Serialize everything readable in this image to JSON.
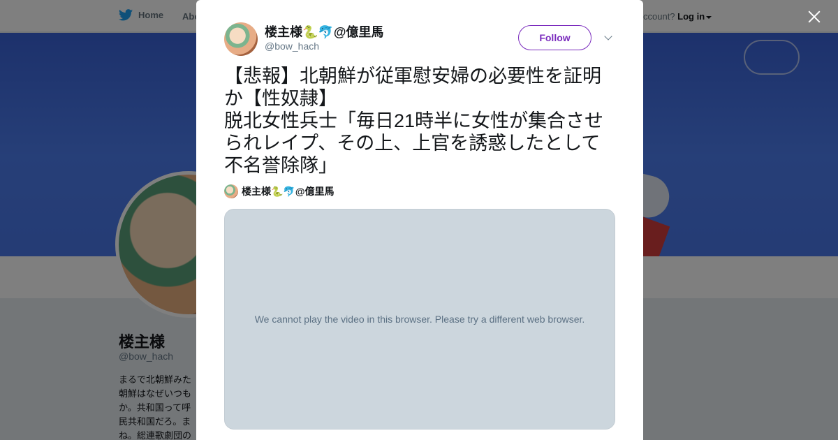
{
  "topbar": {
    "home_label": "Home",
    "about_label": "Abo",
    "account_prompt": "ccount?",
    "login_label": "Log in"
  },
  "profile": {
    "name": "楼主様",
    "handle": "@bow_hach",
    "bio_lines": [
      "まるで北朝鮮みた",
      "朝鮮はなぜいつも",
      "か。共和国って呼",
      "民共和国だろ。ま",
      "ね。総連歌劇団の"
    ]
  },
  "tweet": {
    "author_name": "楼主様🐍🐬@億里馬",
    "author_handle": "@bow_hach",
    "follow_label": "Follow",
    "text": "【悲報】北朝鮮が従軍慰安婦の必要性を証明か【性奴隷】\n脱北女性兵士「毎日21時半に女性が集合させられレイプ、その上、上官を誘惑したとして不名誉除隊」",
    "quote_name": "楼主様🐍🐬@億里馬",
    "video_message": "We cannot play the video in this browser. Please try a different web browser."
  },
  "colors": {
    "accent": "#7a2bbd",
    "twitter_blue": "#1da1f2",
    "video_bg": "#ccd6dd"
  },
  "icons": {
    "home": "twitter-bird-icon",
    "close": "close-icon",
    "menu": "chevron-down-icon"
  }
}
